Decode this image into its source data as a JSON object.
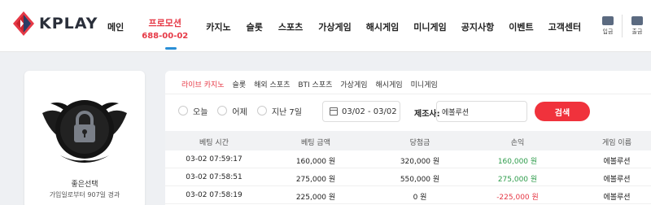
{
  "header": {
    "logo_text": "KPLAY",
    "nav": [
      {
        "label": "메인"
      },
      {
        "label": "프로모션",
        "sub": "688-00-02"
      },
      {
        "label": "카지노"
      },
      {
        "label": "슬롯"
      },
      {
        "label": "스포츠"
      },
      {
        "label": "가상게임"
      },
      {
        "label": "해시게임"
      },
      {
        "label": "미니게임"
      },
      {
        "label": "공지사항"
      },
      {
        "label": "이벤트"
      },
      {
        "label": "고객센터"
      }
    ],
    "buttons": [
      {
        "label": "입금",
        "icon": "deposit-icon"
      },
      {
        "label": "출금",
        "icon": "withdraw-icon"
      }
    ]
  },
  "profile": {
    "name": "좋은선택",
    "subtitle": "가입일로부터 907일 경과"
  },
  "tabs": [
    {
      "label": "라이브 카지노",
      "active": true
    },
    {
      "label": "슬롯"
    },
    {
      "label": "해외 스포츠"
    },
    {
      "label": "BTI 스포츠"
    },
    {
      "label": "가상게임"
    },
    {
      "label": "해시게임"
    },
    {
      "label": "미니게임"
    }
  ],
  "filters": {
    "radios": [
      "오늘",
      "어제",
      "지난 7일"
    ],
    "date_range": "03/02 - 03/02",
    "inquiry_label": "제조사:",
    "inquiry_value": "에볼루션",
    "search_label": "검색"
  },
  "table": {
    "headers": [
      "베팅 시간",
      "베팅 금액",
      "당첨금",
      "손익",
      "게임 이름"
    ],
    "rows": [
      {
        "time": "03-02 07:59:17",
        "bet": "160,000 원",
        "win": "320,000 원",
        "profit": "160,000 원",
        "profit_sign": "pos",
        "game": "에볼루션"
      },
      {
        "time": "03-02 07:58:51",
        "bet": "275,000 원",
        "win": "550,000 원",
        "profit": "275,000 원",
        "profit_sign": "pos",
        "game": "에볼루션"
      },
      {
        "time": "03-02 07:58:19",
        "bet": "225,000 원",
        "win": "0 원",
        "profit": "-225,000 원",
        "profit_sign": "neg",
        "game": "에볼루션"
      }
    ]
  },
  "colors": {
    "accent_red": "#f0323c",
    "positive": "#2e9c4b",
    "negative": "#e63946",
    "active_underline": "#2a8fd6"
  }
}
